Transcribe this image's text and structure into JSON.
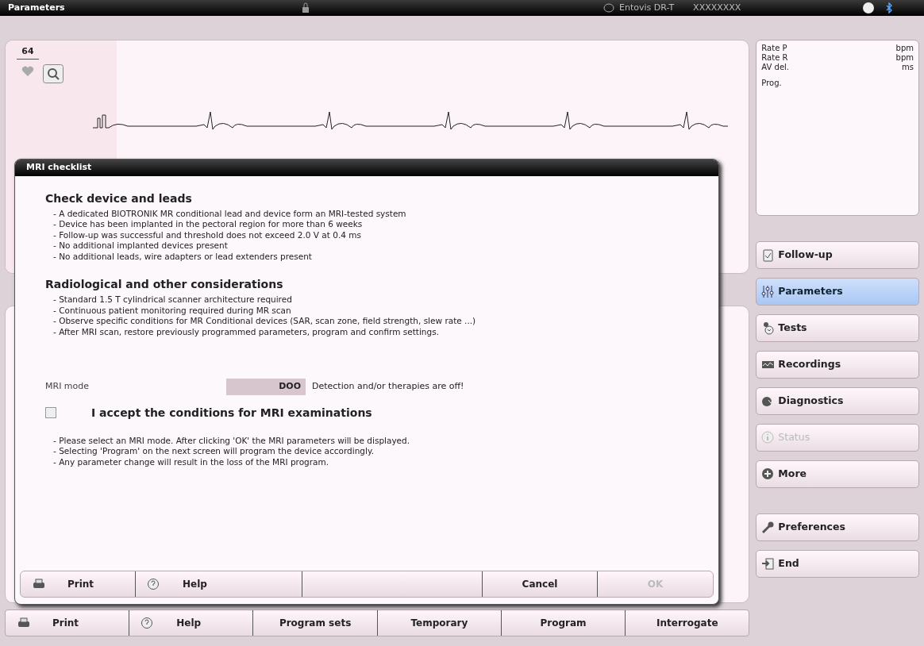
{
  "top_bar": {
    "title": "Parameters",
    "device": "Entovis DR-T",
    "serial": "XXXXXXXX"
  },
  "ecg": {
    "heart_rate": "64"
  },
  "status_box": {
    "rows": [
      {
        "label": "Rate P",
        "unit": "bpm"
      },
      {
        "label": "Rate R",
        "unit": "bpm"
      },
      {
        "label": "AV del.",
        "unit": "ms"
      }
    ],
    "prog_label": "Prog."
  },
  "dialog": {
    "title": "MRI checklist",
    "sections": [
      {
        "heading": "Check device and leads",
        "items": [
          "- A dedicated BIOTRONIK MR conditional lead and device form an MRI-tested system",
          "- Device has been implanted in the pectoral region for more than 6 weeks",
          "- Follow-up was successful and threshold does not exceed 2.0 V at 0.4 ms",
          "- No additional implanted devices present",
          "- No additional leads, wire adapters or lead extenders present"
        ]
      },
      {
        "heading": "Radiological and other considerations",
        "items": [
          "- Standard 1.5 T cylindrical scanner architecture required",
          "- Continuous patient monitoring required during MR scan",
          "- Observe specific conditions for MR Conditional devices (SAR, scan zone, field strength, slew rate ...)",
          "- After MRI scan, restore previously programmed parameters, program and confirm settings."
        ]
      }
    ],
    "mri_mode": {
      "label": "MRI mode",
      "value": "DOO",
      "note": "Detection and/or therapies are off!"
    },
    "accept": {
      "label": "I accept the conditions for MRI examinations",
      "checked": false
    },
    "notes": [
      "- Please select an MRI mode. After clicking 'OK' the MRI parameters will be displayed.",
      "- Selecting 'Program' on the next screen will program the device accordingly.",
      "- Any parameter change will result in the loss of the MRI program."
    ],
    "buttons": [
      {
        "label": "Print",
        "kind": "print",
        "disabled": false
      },
      {
        "label": "Help",
        "kind": "help",
        "disabled": false
      },
      {
        "label": "Cancel",
        "kind": "text",
        "disabled": false
      },
      {
        "label": "OK",
        "kind": "text",
        "disabled": true
      }
    ]
  },
  "nav": [
    {
      "label": "Follow-up",
      "kind": "clipboard",
      "selected": false,
      "disabled": false
    },
    {
      "label": "Parameters",
      "kind": "sliders",
      "selected": true,
      "disabled": false
    },
    {
      "label": "Tests",
      "kind": "tests",
      "selected": false,
      "disabled": false
    },
    {
      "label": "Recordings",
      "kind": "recordings",
      "selected": false,
      "disabled": false
    },
    {
      "label": "Diagnostics",
      "kind": "diagnostics",
      "selected": false,
      "disabled": false
    },
    {
      "label": "Status",
      "kind": "info",
      "selected": false,
      "disabled": true
    },
    {
      "label": "More",
      "kind": "plus",
      "selected": false,
      "disabled": false
    },
    {
      "label": "Preferences",
      "kind": "wrench",
      "selected": false,
      "disabled": false
    },
    {
      "label": "End",
      "kind": "exit",
      "selected": false,
      "disabled": false
    }
  ],
  "toolbar": [
    {
      "label": "Print",
      "kind": "print"
    },
    {
      "label": "Help",
      "kind": "help"
    },
    {
      "label": "Program sets",
      "kind": "text"
    },
    {
      "label": "Temporary",
      "kind": "text"
    },
    {
      "label": "Program",
      "kind": "text"
    },
    {
      "label": "Interrogate",
      "kind": "text"
    }
  ]
}
